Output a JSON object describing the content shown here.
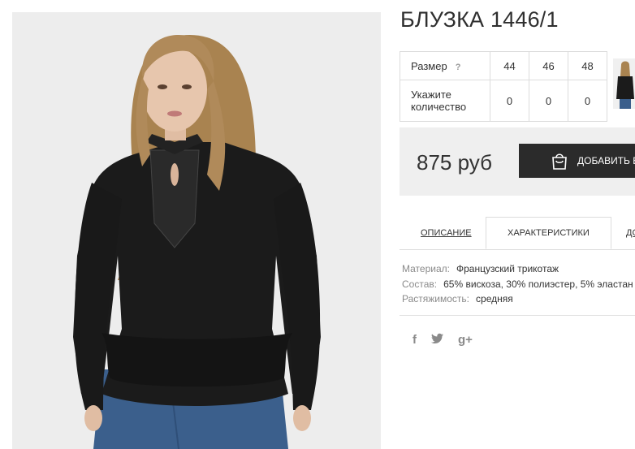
{
  "product": {
    "title": "БЛУЗКА 1446/1"
  },
  "size_table": {
    "size_label": "Размер",
    "help_mark": "?",
    "qty_label": "Укажите количество",
    "sizes": [
      "44",
      "46",
      "48"
    ],
    "quantities": [
      "0",
      "0",
      "0"
    ]
  },
  "buy": {
    "price": "875 руб",
    "add_button": "ДОБАВИТЬ В"
  },
  "tabs": {
    "description": "ОПИСАНИЕ",
    "characteristics": "ХАРАКТЕРИСТИКИ",
    "third": "ДО"
  },
  "specs": [
    {
      "key": "Материал:",
      "value": "Французский трикотаж"
    },
    {
      "key": "Состав:",
      "value": "65% вискоза, 30% полиэстер, 5% эластан"
    },
    {
      "key": "Растяжимость:",
      "value": "средняя"
    }
  ],
  "social": {
    "facebook": "f",
    "twitter": "🐦",
    "googleplus": "g+"
  },
  "colors": {
    "button_bg": "#2b2b2b",
    "buybox_bg": "#efefef",
    "photo_bg": "#ededed",
    "blouse": "#1b1b1b",
    "jeans": "#3b5f8c",
    "hair": "#b08a5a"
  }
}
